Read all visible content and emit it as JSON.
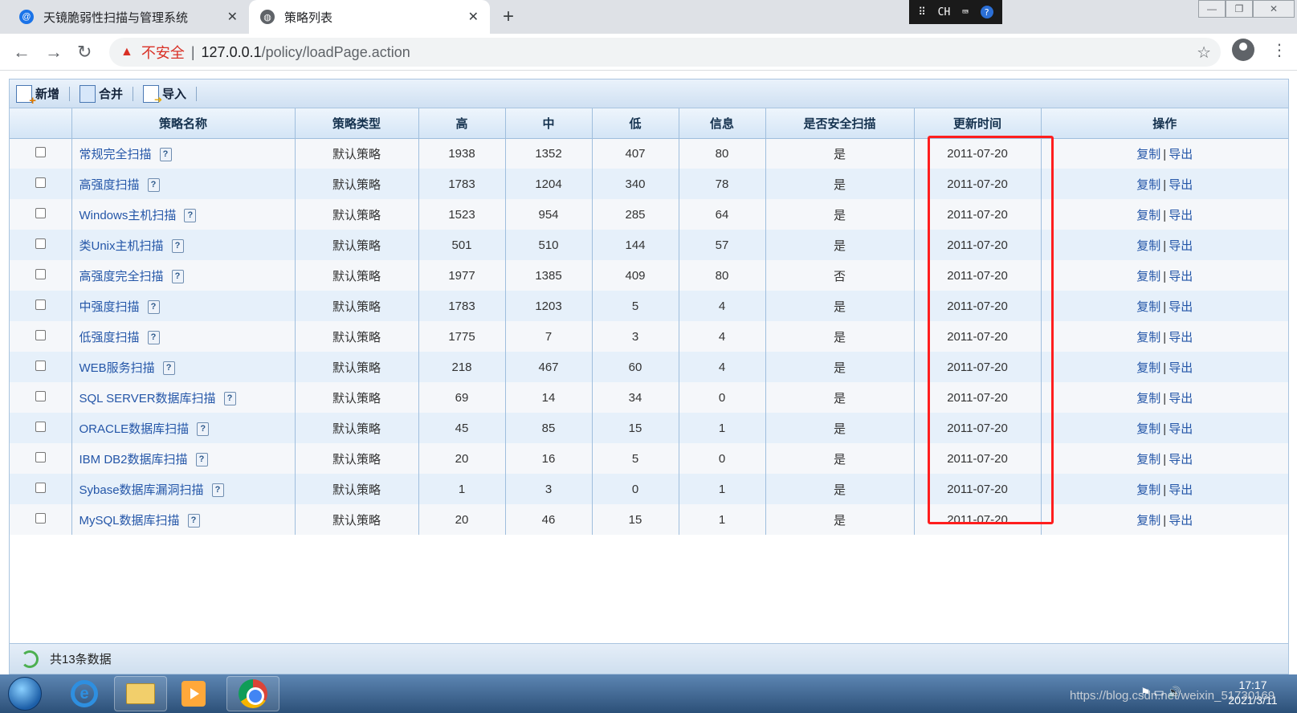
{
  "browser": {
    "tabs": [
      {
        "title": "天镜脆弱性扫描与管理系统",
        "active": false
      },
      {
        "title": "策略列表",
        "active": true
      }
    ],
    "new_tab_symbol": "+",
    "ime": {
      "lang": "CH",
      "help": "?"
    },
    "address": {
      "security_label": "不安全",
      "separator": "|",
      "host": "127.0.0.1",
      "path": "/policy/loadPage.action"
    }
  },
  "toolbar": {
    "add_label": "新增",
    "merge_label": "合并",
    "import_label": "导入"
  },
  "table": {
    "headers": [
      "策略名称",
      "策略类型",
      "高",
      "中",
      "低",
      "信息",
      "是否安全扫描",
      "更新时间",
      "操作"
    ],
    "rows": [
      {
        "name": "常规完全扫描",
        "type": "默认策略",
        "high": "1938",
        "mid": "1352",
        "low": "407",
        "info": "80",
        "safe": "是",
        "updated": "2011-07-20"
      },
      {
        "name": "高强度扫描",
        "type": "默认策略",
        "high": "1783",
        "mid": "1204",
        "low": "340",
        "info": "78",
        "safe": "是",
        "updated": "2011-07-20"
      },
      {
        "name": "Windows主机扫描",
        "type": "默认策略",
        "high": "1523",
        "mid": "954",
        "low": "285",
        "info": "64",
        "safe": "是",
        "updated": "2011-07-20"
      },
      {
        "name": "类Unix主机扫描",
        "type": "默认策略",
        "high": "501",
        "mid": "510",
        "low": "144",
        "info": "57",
        "safe": "是",
        "updated": "2011-07-20"
      },
      {
        "name": "高强度完全扫描",
        "type": "默认策略",
        "high": "1977",
        "mid": "1385",
        "low": "409",
        "info": "80",
        "safe": "否",
        "updated": "2011-07-20"
      },
      {
        "name": "中强度扫描",
        "type": "默认策略",
        "high": "1783",
        "mid": "1203",
        "low": "5",
        "info": "4",
        "safe": "是",
        "updated": "2011-07-20"
      },
      {
        "name": "低强度扫描",
        "type": "默认策略",
        "high": "1775",
        "mid": "7",
        "low": "3",
        "info": "4",
        "safe": "是",
        "updated": "2011-07-20"
      },
      {
        "name": "WEB服务扫描",
        "type": "默认策略",
        "high": "218",
        "mid": "467",
        "low": "60",
        "info": "4",
        "safe": "是",
        "updated": "2011-07-20"
      },
      {
        "name": "SQL SERVER数据库扫描",
        "type": "默认策略",
        "high": "69",
        "mid": "14",
        "low": "34",
        "info": "0",
        "safe": "是",
        "updated": "2011-07-20"
      },
      {
        "name": "ORACLE数据库扫描",
        "type": "默认策略",
        "high": "45",
        "mid": "85",
        "low": "15",
        "info": "1",
        "safe": "是",
        "updated": "2011-07-20"
      },
      {
        "name": "IBM DB2数据库扫描",
        "type": "默认策略",
        "high": "20",
        "mid": "16",
        "low": "5",
        "info": "0",
        "safe": "是",
        "updated": "2011-07-20"
      },
      {
        "name": "Sybase数据库漏洞扫描",
        "type": "默认策略",
        "high": "1",
        "mid": "3",
        "low": "0",
        "info": "1",
        "safe": "是",
        "updated": "2011-07-20"
      },
      {
        "name": "MySQL数据库扫描",
        "type": "默认策略",
        "high": "20",
        "mid": "46",
        "low": "15",
        "info": "1",
        "safe": "是",
        "updated": "2011-07-20"
      }
    ],
    "actions": {
      "copy": "复制",
      "export": "导出",
      "sep": "|"
    },
    "help_icon": "?"
  },
  "footer": {
    "summary": "共13条数据"
  },
  "taskbar": {
    "time": "17:17",
    "date": "2021/3/11",
    "watermark": "https://blog.csdn.net/weixin_51730169"
  },
  "colors": {
    "highlight": "#ff1e1e",
    "link": "#2456a8",
    "insecure": "#d93025"
  }
}
